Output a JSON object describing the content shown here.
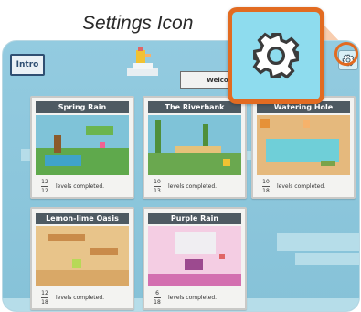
{
  "callout": {
    "title": "Settings Icon",
    "accent_color": "#e26b21",
    "zoom_icon": "gear-icon"
  },
  "header": {
    "intro_label": "Intro",
    "welcome_text": "Welcome to C",
    "settings_icon": "gear-icon"
  },
  "cards": [
    {
      "title": "Spring Rain",
      "completed": "12",
      "total": "12",
      "label": "levels completed."
    },
    {
      "title": "The Riverbank",
      "completed": "10",
      "total": "13",
      "label": "levels completed."
    },
    {
      "title": "Watering Hole",
      "completed": "10",
      "total": "18",
      "label": "levels completed."
    },
    {
      "title": "Lemon-lime Oasis",
      "completed": "12",
      "total": "18",
      "label": "levels completed."
    },
    {
      "title": "Purple Rain",
      "completed": "6",
      "total": "18",
      "label": "levels completed."
    }
  ]
}
